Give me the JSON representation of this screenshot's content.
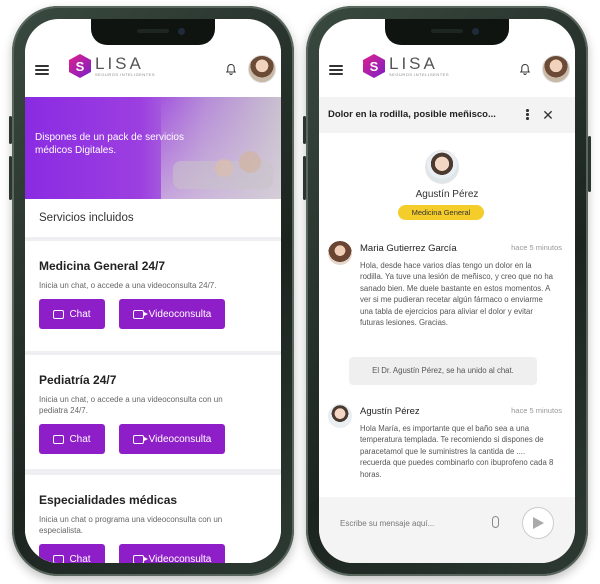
{
  "left": {
    "logo": {
      "letter": "S",
      "word": "LISA",
      "tagline": "SEGUROS INTELIGENTES"
    },
    "banner_text": "Dispones de un pack de servicios médicos Digitales.",
    "section_title": "Servicios incluidos",
    "cards": [
      {
        "title": "Medicina General 24/7",
        "desc": "Inicia un chat, o accede a una videoconsulta 24/7.",
        "btn1": "Chat",
        "btn2": "Videoconsulta"
      },
      {
        "title": "Pediatría 24/7",
        "desc": "Inicia un chat, o accede a una videoconsulta con un pediatra 24/7.",
        "btn1": "Chat",
        "btn2": "Videoconsulta"
      },
      {
        "title": "Especialidades médicas",
        "desc": "Inicia un chat o programa una videoconsulta con un especialista.",
        "btn1": "Chat",
        "btn2": "Videoconsulta"
      }
    ]
  },
  "right": {
    "logo": {
      "letter": "S",
      "word": "LISA",
      "tagline": "SEGUROS INTELIGENTES"
    },
    "chat_title": "Dolor en la rodilla, posible meñisco...",
    "doctor_name": "Agustín Pérez",
    "specialty": "Medicina General",
    "messages": [
      {
        "name": "Maria Gutierrez García",
        "time": "hace 5 minutos",
        "text": "Hola, desde hace varios días tengo un dolor en la rodilla. Ya tuve una lesión de meñisco, y creo que no ha sanado bien. Me duele bastante en estos momentos. A ver si me pudieran recetar algún fármaco o enviarme una tabla de ejercicios para aliviar el dolor y evitar futuras lesiones. Gracias."
      },
      {
        "name": "Agustín Pérez",
        "time": "hace 5 minutos",
        "text": "Hola María, es importante que el baño sea a una temperatura templada. Te recomiendo si dispones de paracetamol que le suministres la cantida de .... recuerda que puedes combinarlo con ibuprofeno cada 8 horas."
      }
    ],
    "system_message": "El Dr. Agustín Pérez, se ha unido al chat.",
    "composer_placeholder": "Escribe su mensaje aquí..."
  },
  "colors": {
    "primary": "#8e1fc8",
    "pill": "#f4cd2a"
  }
}
